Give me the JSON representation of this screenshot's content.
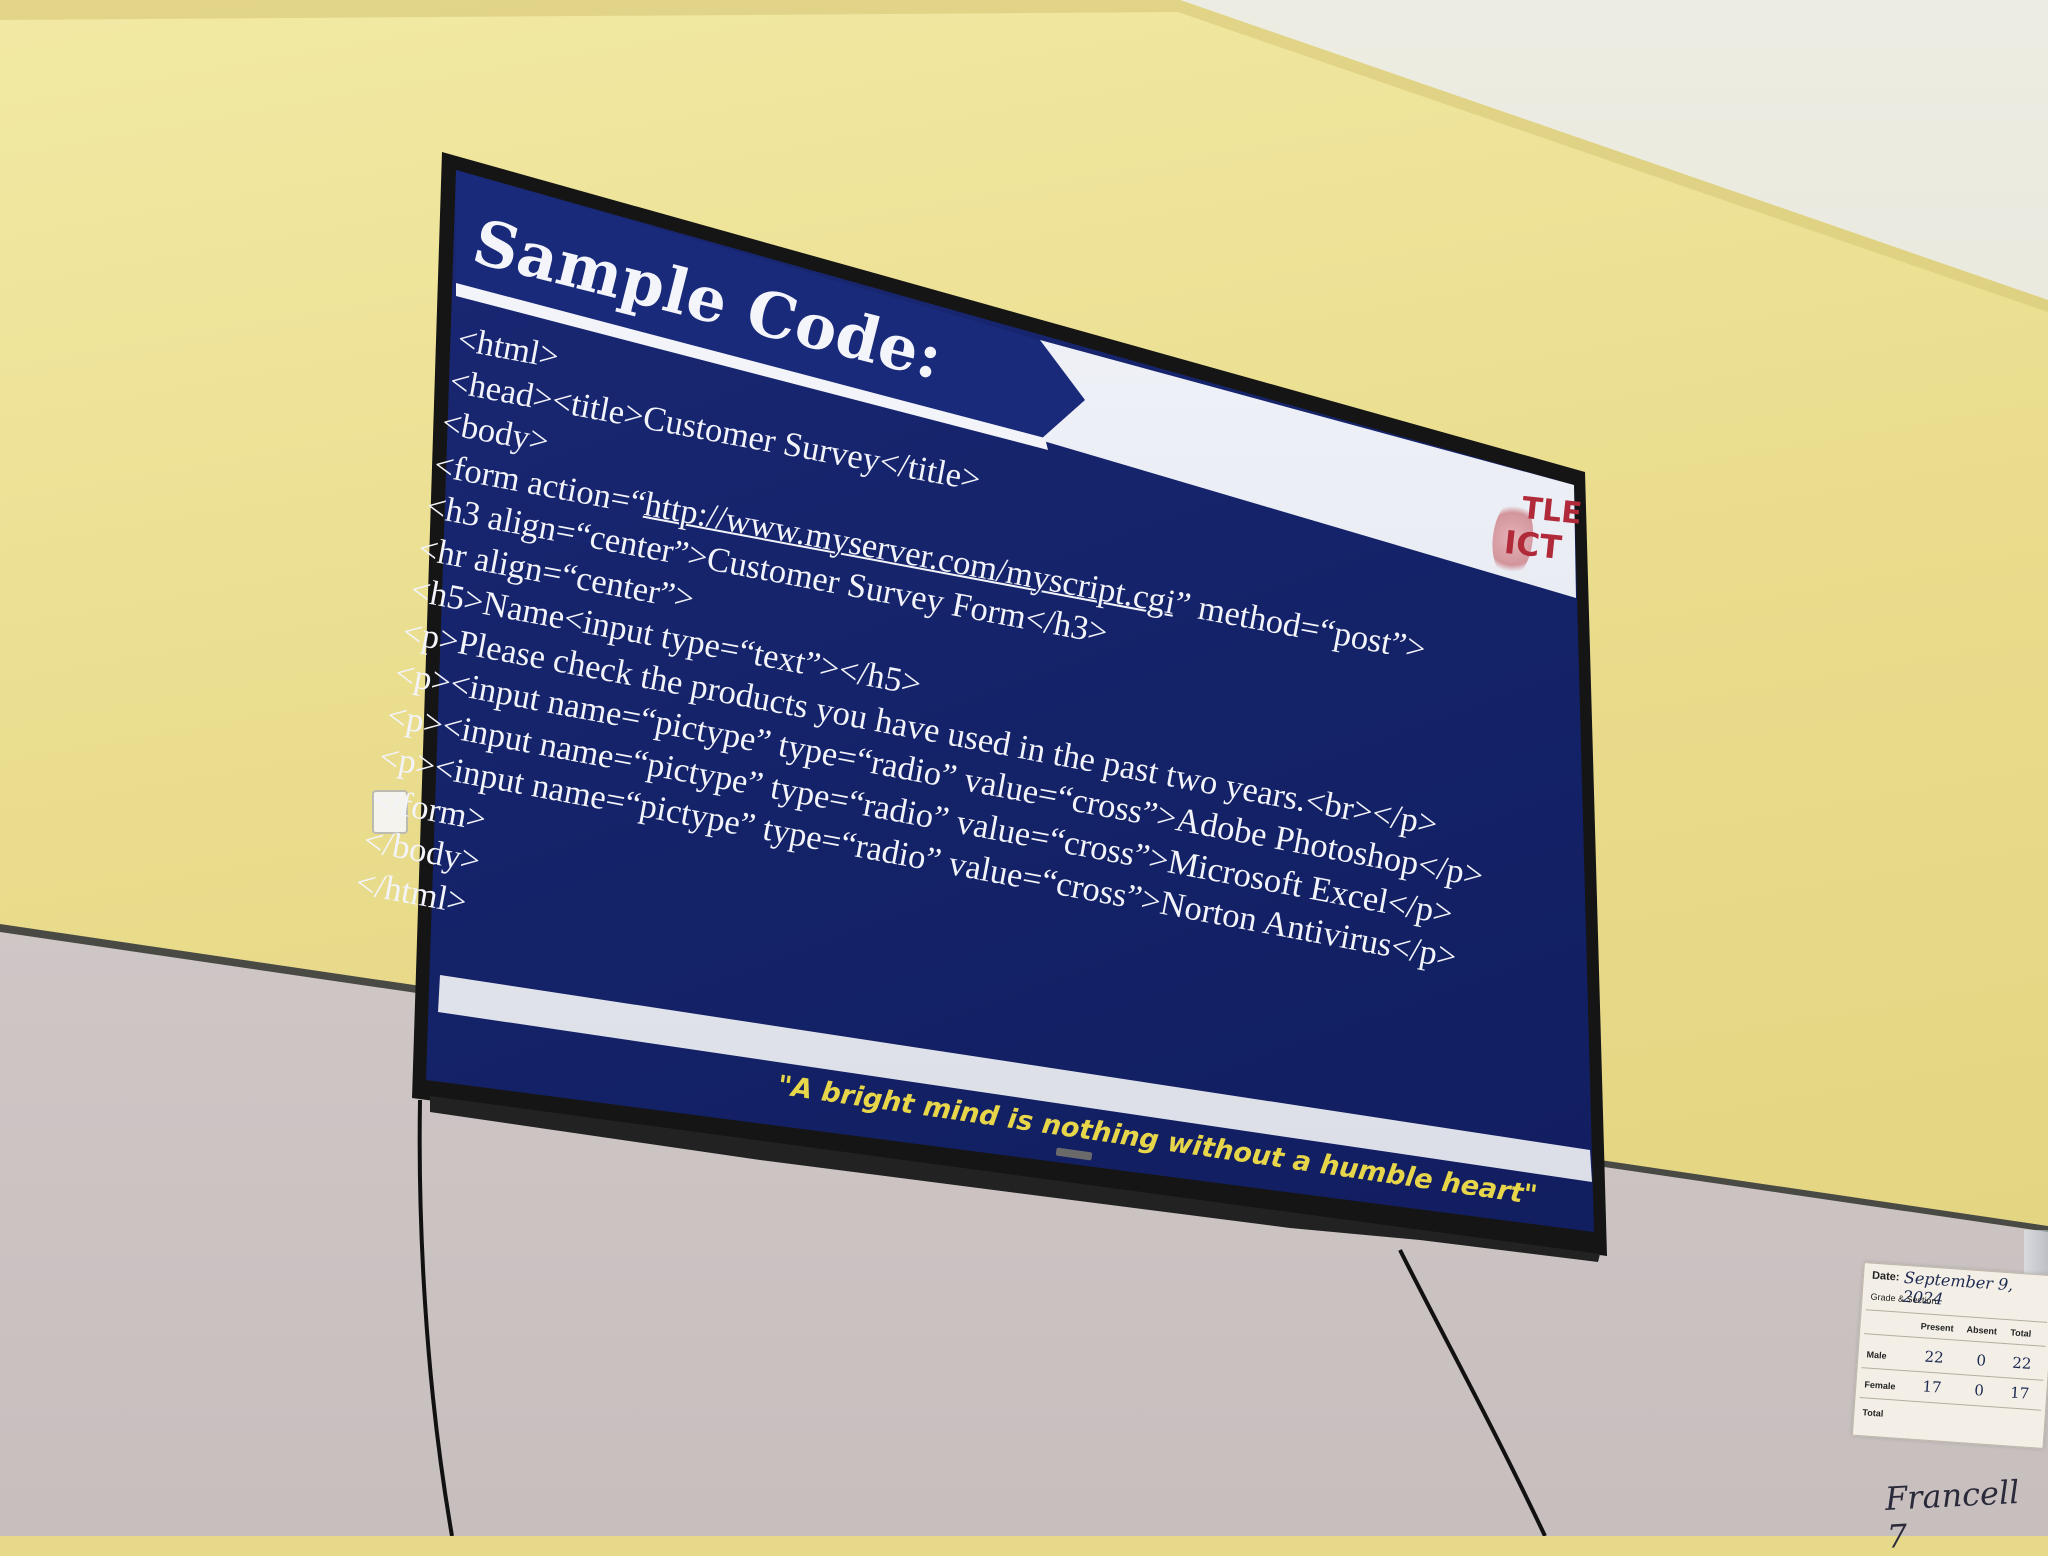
{
  "slide": {
    "title": "Sample Code:",
    "code_lines": [
      "<html>",
      "<head><title>Customer Survey</title>",
      "<body>",
      "<form action=“",
      "http://www.myserver.com/myscript.cgi",
      "” method=“post”>",
      "<h3 align=“center”>Customer Survey Form</h3>",
      "<hr align=“center”>",
      "<h5>Name<input type=“text”></h5>",
      "<p>Please check the products you have used in the past two years.<br></p>",
      "<p><input name=“pictype” type=“radio” value=“cross”>Adobe Photoshop</p>",
      "<p><input name=“pictype” type=“radio” value=“cross”>Microsoft Excel</p>",
      "<p><input name=“pictype” type=“radio” value=“cross”>Norton Antivirus</p>",
      "</form>",
      "</body>",
      "</html>"
    ],
    "quote": "\"A bright mind is nothing without a humble heart\"",
    "logo_line1": "TLE",
    "logo_line2": "ICT",
    "colors": {
      "slide_background": "#142268",
      "text": "#f3f4fa",
      "quote": "#e7d64a",
      "logo": "#b02a3a"
    }
  },
  "attendance_card": {
    "date_label": "Date:",
    "date_value": "September 9, 2024",
    "grade_label": "Grade & Section:",
    "headers": [
      "Present",
      "Absent",
      "Total"
    ],
    "rows": [
      {
        "label": "Male",
        "present": "22",
        "absent": "0",
        "total": "22"
      },
      {
        "label": "Female",
        "present": "17",
        "absent": "0",
        "total": "17"
      },
      {
        "label": "Total",
        "present": "",
        "absent": "",
        "total": ""
      }
    ]
  },
  "handwriting": "Francell 7"
}
